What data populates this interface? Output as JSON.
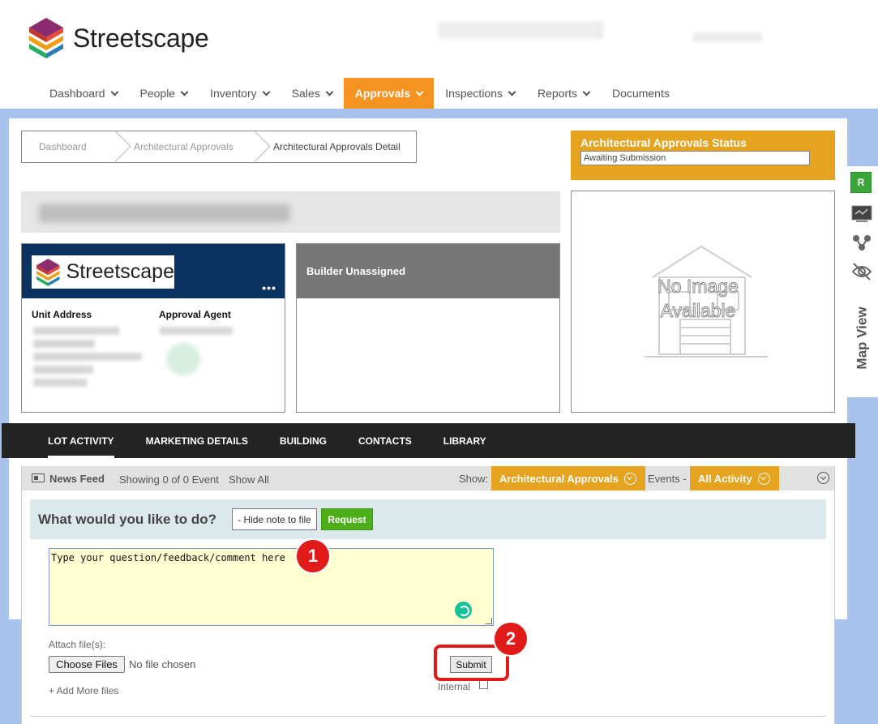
{
  "brand": {
    "name": "Streetscape"
  },
  "nav": {
    "items": [
      {
        "label": "Dashboard",
        "has_menu": true
      },
      {
        "label": "People",
        "has_menu": true
      },
      {
        "label": "Inventory",
        "has_menu": true
      },
      {
        "label": "Sales",
        "has_menu": true
      },
      {
        "label": "Approvals",
        "has_menu": true,
        "active": true
      },
      {
        "label": "Inspections",
        "has_menu": true
      },
      {
        "label": "Reports",
        "has_menu": true
      },
      {
        "label": "Documents",
        "has_menu": false
      }
    ]
  },
  "breadcrumb": [
    "Dashboard",
    "Architectural Approvals",
    "Architectural Approvals Detail"
  ],
  "status": {
    "title": "Architectural Approvals Status",
    "value": "Awaiting Submission"
  },
  "no_image": {
    "line1": "No Image",
    "line2": "Available"
  },
  "company_card": {
    "more": "•••",
    "unit_address_label": "Unit Address",
    "approval_agent_label": "Approval Agent"
  },
  "builder_card": {
    "title": "Builder Unassigned"
  },
  "side_tools": {
    "badge": "R",
    "map_view": "Map View"
  },
  "tabs": [
    "LOT ACTIVITY",
    "MARKETING DETAILS",
    "BUILDING",
    "CONTACTS",
    "LIBRARY"
  ],
  "feed": {
    "title": "News Feed",
    "count": "Showing 0 of 0 Event",
    "show_all": "Show All",
    "show_label": "Show:",
    "filter_type": "Architectural Approvals",
    "events_label": "Events -",
    "filter_activity": "All Activity"
  },
  "compose": {
    "prompt": "What would you like to do?",
    "hide_note": "- Hide note to file",
    "request": "Request",
    "comment_value": "Type your question/feedback/comment here",
    "attach_label": "Attach file(s):",
    "choose_files": "Choose Files",
    "no_file": "No file chosen",
    "add_more": "+ Add More files",
    "submit": "Submit",
    "internal": "Internal"
  },
  "annotations": {
    "marker_1": "1",
    "marker_2": "2"
  },
  "colors": {
    "accent": "#f4931f",
    "status": "#e5a320",
    "navy": "#0b3362",
    "green": "#4caf1a",
    "annotation": "#e11a1a"
  }
}
